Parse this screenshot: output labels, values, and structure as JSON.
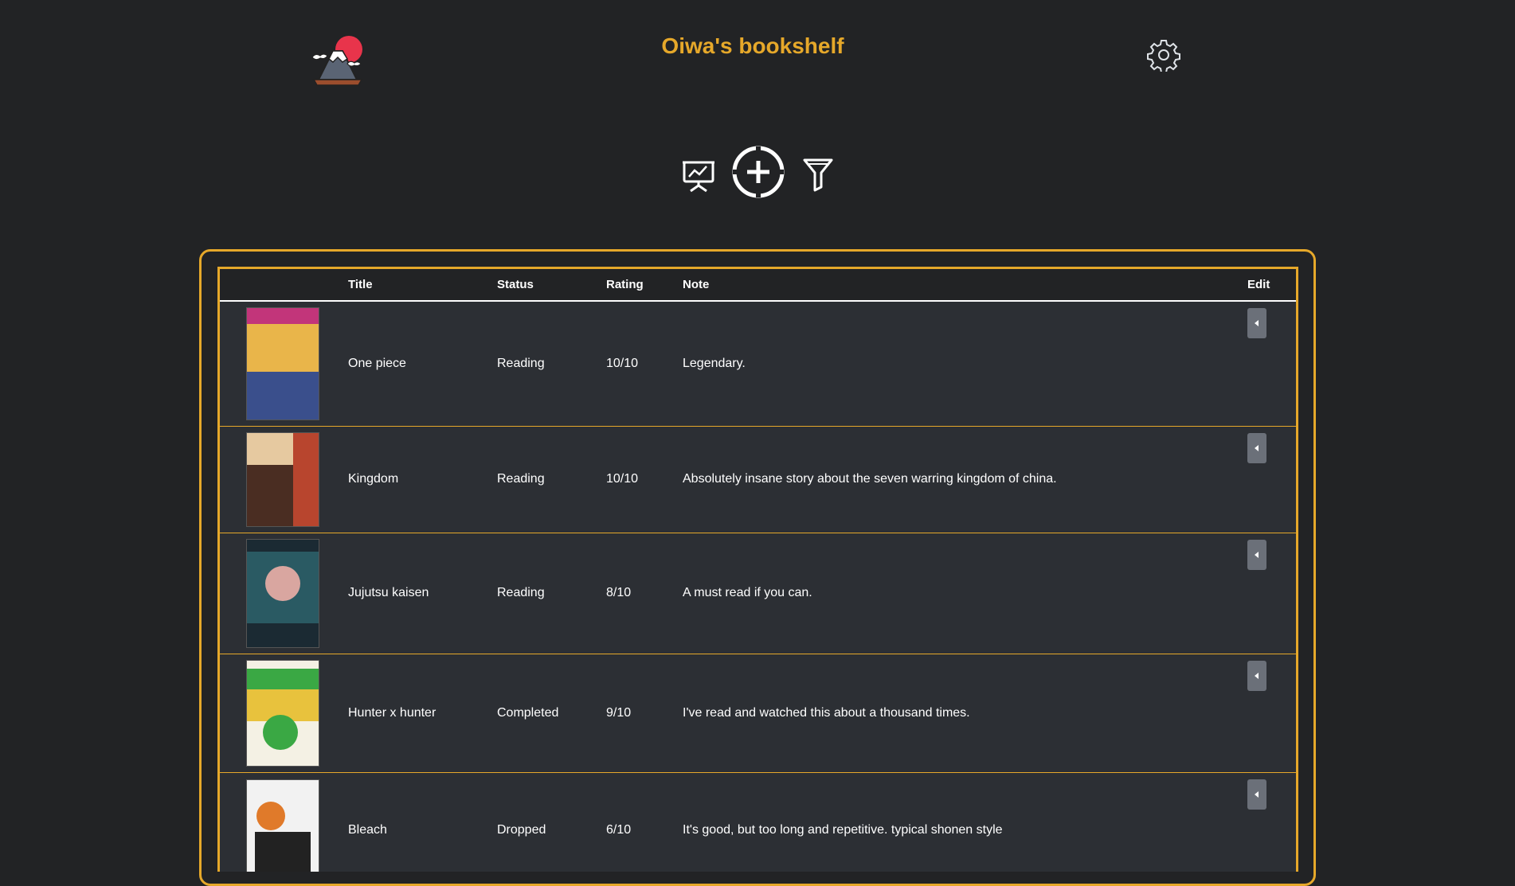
{
  "header": {
    "title": "Oiwa's bookshelf",
    "logo_icon": "mount-fuji-sun-icon",
    "settings_icon": "gear-icon"
  },
  "toolbar": {
    "stats_icon": "presentation-chart-icon",
    "add_icon": "add-circle-icon",
    "filter_icon": "filter-funnel-icon"
  },
  "colors": {
    "accent": "#e6a82a",
    "background": "#222325",
    "table_row": "#2c2f34",
    "edit_button": "#6b7079"
  },
  "table": {
    "columns": {
      "cover": "",
      "title": "Title",
      "status": "Status",
      "rating": "Rating",
      "note": "Note",
      "edit": "Edit"
    },
    "rows": [
      {
        "title": "One piece",
        "status": "Reading",
        "rating": "10/10",
        "note": "Legendary.",
        "cover_colors": [
          "#c2357a",
          "#e9b54a",
          "#3a4f8c"
        ]
      },
      {
        "title": "Kingdom",
        "status": "Reading",
        "rating": "10/10",
        "note": "Absolutely insane story about the seven warring kingdom of china.",
        "cover_colors": [
          "#b8452e",
          "#e6c9a0",
          "#4a2d22"
        ]
      },
      {
        "title": "Jujutsu kaisen",
        "status": "Reading",
        "rating": "8/10",
        "note": "A must read if you can.",
        "cover_colors": [
          "#2a5a63",
          "#d9a6a0",
          "#1b2a33"
        ]
      },
      {
        "title": "Hunter x hunter",
        "status": "Completed",
        "rating": "9/10",
        "note": "I've read and watched this about a thousand times.",
        "cover_colors": [
          "#f4f1e4",
          "#3aa844",
          "#e8c23d"
        ]
      },
      {
        "title": "Bleach",
        "status": "Dropped",
        "rating": "6/10",
        "note": "It's good, but too long and repetitive. typical shonen style",
        "cover_colors": [
          "#f2f2f2",
          "#e07a2a",
          "#222222"
        ]
      }
    ]
  }
}
